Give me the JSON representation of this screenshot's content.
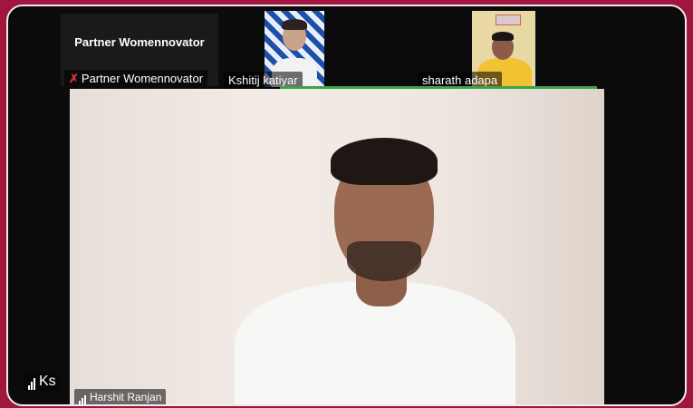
{
  "participants": {
    "top_left": {
      "tile_name": "Partner Womennovator",
      "label": "Partner Womennovator",
      "status_icon": "mic-muted-icon"
    },
    "kshitij": {
      "label": "Kshitij katiyar"
    },
    "sharath": {
      "label": "sharath adapa"
    },
    "main": {
      "label": "Harshit Ranjan",
      "status_icon": "signal-icon"
    },
    "bottom_left": {
      "label": "Ks",
      "status_icon": "signal-icon"
    }
  },
  "colors": {
    "background": "#a0163e",
    "frame": "#0b0b0c",
    "active_speaker_bar": "#3aa34a"
  }
}
